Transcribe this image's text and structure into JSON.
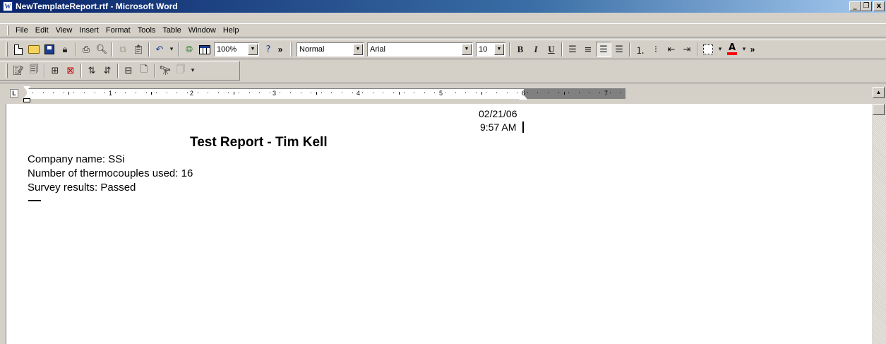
{
  "window": {
    "title": "NewTemplateReport.rtf - Microsoft Word",
    "app_icon": "W",
    "minimize": "_",
    "maximize": "́",
    "close": "x"
  },
  "menu": [
    "File",
    "Edit",
    "View",
    "Insert",
    "Format",
    "Tools",
    "Table",
    "Window",
    "Help"
  ],
  "toolbar": {
    "zoom": "100%",
    "style": "Normal",
    "font": "Arial",
    "size": "10",
    "bold": "B",
    "italic": "I",
    "underline": "U",
    "font_color": "A",
    "overflow": "»"
  },
  "ruler": {
    "tab_marker": "L",
    "numbers": [
      "1",
      "2",
      "3",
      "4",
      "5",
      "6",
      "7"
    ]
  },
  "document": {
    "date": "02/21/06",
    "time": "9:57 AM",
    "title": "Test Report - Tim Kell",
    "lines": [
      "Company name: SSi",
      "Number of thermocouples used: 16",
      "Survey results: Passed"
    ]
  },
  "colors": {
    "titlebar_start": "#0a246a",
    "titlebar_end": "#a6caf0",
    "chrome": "#d4d0c8"
  }
}
